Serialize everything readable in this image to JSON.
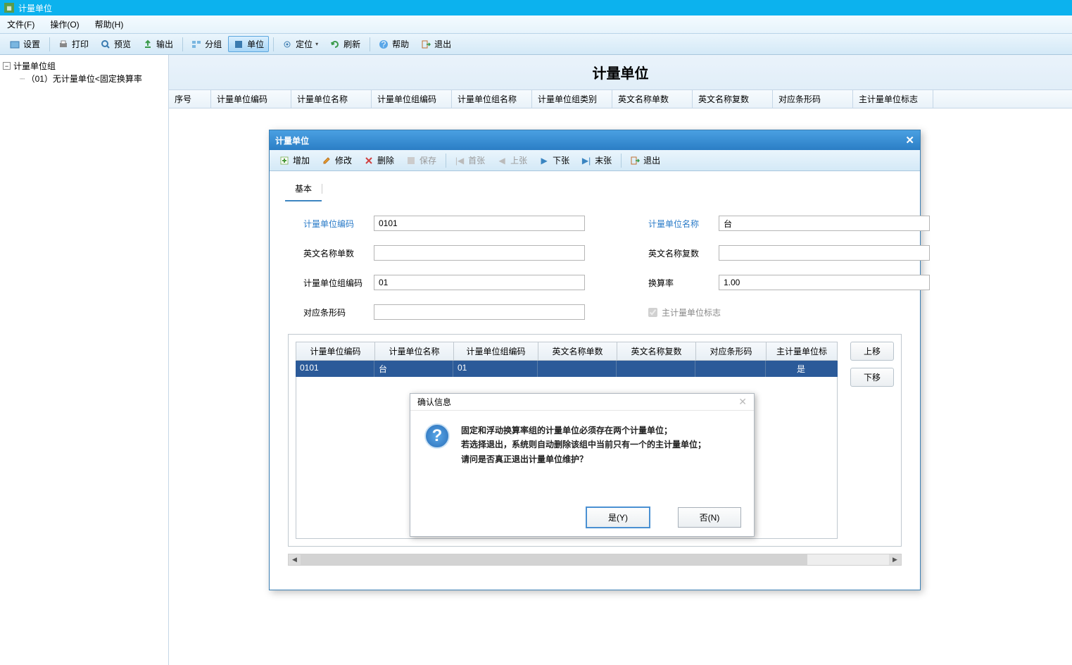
{
  "window": {
    "title": "计量单位"
  },
  "menu": {
    "file": "文件(F)",
    "operate": "操作(O)",
    "help": "帮助(H)"
  },
  "toolbar": {
    "settings": "设置",
    "print": "打印",
    "preview": "预览",
    "export": "输出",
    "group": "分组",
    "unit": "单位",
    "locate": "定位",
    "refresh": "刷新",
    "help": "帮助",
    "exit": "退出"
  },
  "tree": {
    "root": "计量单位组",
    "child": "（01）无计量单位<固定换算率"
  },
  "page": {
    "title": "计量单位"
  },
  "grid": {
    "cols": [
      "序号",
      "计量单位编码",
      "计量单位名称",
      "计量单位组编码",
      "计量单位组名称",
      "计量单位组类别",
      "英文名称单数",
      "英文名称复数",
      "对应条形码",
      "主计量单位标志"
    ]
  },
  "dialog": {
    "title": "计量单位",
    "tb": {
      "add": "增加",
      "edit": "修改",
      "del": "删除",
      "save": "保存",
      "first": "首张",
      "prev": "上张",
      "next": "下张",
      "last": "末张",
      "exit": "退出"
    },
    "tab": "基本",
    "form": {
      "code_label": "计量单位编码",
      "code_val": "0101",
      "name_label": "计量单位名称",
      "name_val": "台",
      "en_s_label": "英文名称单数",
      "en_s_val": "",
      "en_p_label": "英文名称复数",
      "en_p_val": "",
      "grp_code_label": "计量单位组编码",
      "grp_code_val": "01",
      "rate_label": "换算率",
      "rate_val": "1.00",
      "barcode_label": "对应条形码",
      "barcode_val": "",
      "mainflag_label": "主计量单位标志"
    },
    "inner_grid": {
      "cols": [
        "计量单位编码",
        "计量单位名称",
        "计量单位组编码",
        "英文名称单数",
        "英文名称复数",
        "对应条形码",
        "主计量单位标"
      ],
      "row": [
        "0101",
        "台",
        "01",
        "",
        "",
        "",
        "是"
      ]
    },
    "side": {
      "up": "上移",
      "down": "下移"
    }
  },
  "msg": {
    "title": "确认信息",
    "line1": "固定和浮动换算率组的计量单位必须存在两个计量单位；",
    "line2": "若选择退出，系统则自动删除该组中当前只有一个的主计量单位；",
    "line3": "请问是否真正退出计量单位维护？",
    "yes": "是(Y)",
    "no": "否(N)"
  }
}
